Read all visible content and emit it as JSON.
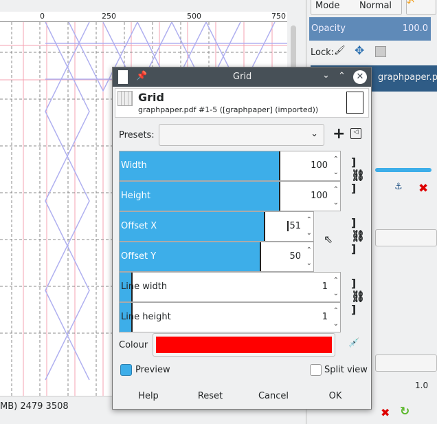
{
  "ruler": {
    "ticks": [
      "0",
      "250",
      "500",
      "750"
    ]
  },
  "status": {
    "text": "MB) 2479 3508"
  },
  "layers": {
    "mode_label": "Mode",
    "mode_value": "Normal",
    "opacity_label": "Opacity",
    "opacity_value": "100.0",
    "lock_label": "Lock:",
    "layer_name": "graphpaper.pdf",
    "spacing_value": "1.0"
  },
  "dialog": {
    "title": "Grid",
    "heading": "Grid",
    "subtitle": "graphpaper.pdf #1-5 ([graphpaper] (imported))",
    "presets_label": "Presets:",
    "presets_value": "",
    "fields": [
      {
        "label": "Width",
        "value": "100",
        "fill": 0.73
      },
      {
        "label": "Height",
        "value": "100",
        "fill": 0.73
      },
      {
        "label": "Offset X",
        "value": "51",
        "fill": 0.75
      },
      {
        "label": "Offset Y",
        "value": "50",
        "fill": 0.73
      },
      {
        "label": "Line width",
        "value": "1",
        "fill": 0.06
      },
      {
        "label": "Line height",
        "value": "1",
        "fill": 0.06
      }
    ],
    "colour_label": "Colour",
    "colour_value": "#ff0000",
    "preview_label": "Preview",
    "preview_checked": true,
    "split_label": "Split view",
    "split_checked": false,
    "buttons": {
      "help": "Help",
      "reset": "Reset",
      "cancel": "Cancel",
      "ok": "OK"
    }
  }
}
